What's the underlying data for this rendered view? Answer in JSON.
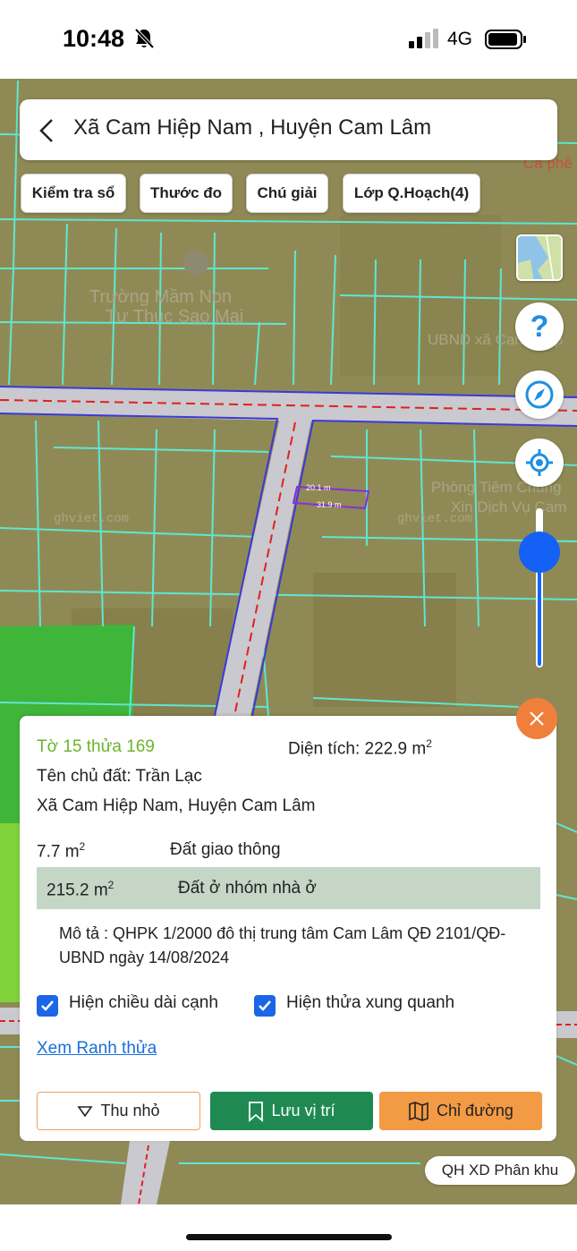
{
  "status_bar": {
    "time": "10:48",
    "network": "4G",
    "icons": [
      "bell-off-icon",
      "signal-icon",
      "battery-icon"
    ]
  },
  "search": {
    "title": "Xã Cam Hiệp Nam , Huyện Cam Lâm"
  },
  "chips": [
    {
      "label": "Kiểm tra sổ"
    },
    {
      "label": "Thước đo"
    },
    {
      "label": "Chú giải"
    },
    {
      "label": "Lớp Q.Hoạch(4)"
    }
  ],
  "map": {
    "labels": {
      "school": "Trường Mầm Non",
      "school2": "Tư Thục Sao Mai",
      "ubnd": "UBND xã Cam Hiệp",
      "clinic": "Phòng Tiêm Chủng",
      "clinic2": "Xin Dịch Vụ Cam",
      "cafe": "Cà phê",
      "watermark": "ghviet.com"
    },
    "parcel": {
      "edge_top": "20.1 m",
      "edge_bottom": "31.9 m"
    },
    "controls": [
      "map-layer-thumbnail",
      "help-icon",
      "compass-icon",
      "locate-icon",
      "zoom-slider"
    ],
    "zoom_level_fraction": 0.88,
    "colors": {
      "land": "#8f8a55",
      "parcel_line": "#5fe6d2",
      "road": "#c9c9cf",
      "road_dash": "#e02020",
      "boundary": "#3a3ad8",
      "green_zone": "#3fb53a",
      "light_green_zone": "#7fd23a"
    }
  },
  "panel": {
    "parcel_id": "Tờ 15 thửa 169",
    "area_label": "Diện tích: 222.9 m",
    "area_sup": "2",
    "owner": "Tên chủ đất: Trần Lạc",
    "address": "Xã Cam Hiệp Nam, Huyện Cam Lâm",
    "land_use": [
      {
        "area": "7.7 m",
        "sup": "2",
        "type": "Đất giao thông"
      },
      {
        "area": "215.2 m",
        "sup": "2",
        "type": "Đất ở nhóm nhà ở"
      }
    ],
    "description": "Mô tả : QHPK 1/2000 đô thị trung tâm Cam Lâm QĐ 2101/QĐ-UBND ngày 14/08/2024",
    "checkbox_edges": "Hiện chiều dài cạnh",
    "checkbox_neighbors": "Hiện thửa xung quanh",
    "link": "Xem Ranh thửa",
    "buttons": {
      "shrink": "Thu nhỏ",
      "save": "Lưu vị trí",
      "route": "Chỉ đường"
    },
    "colors": {
      "save": "#1e8a52",
      "route": "#f39a45",
      "close": "#f07f3c",
      "highlight_row": "#c5d6c6"
    }
  },
  "plan_badge": "QH XD Phân khu"
}
